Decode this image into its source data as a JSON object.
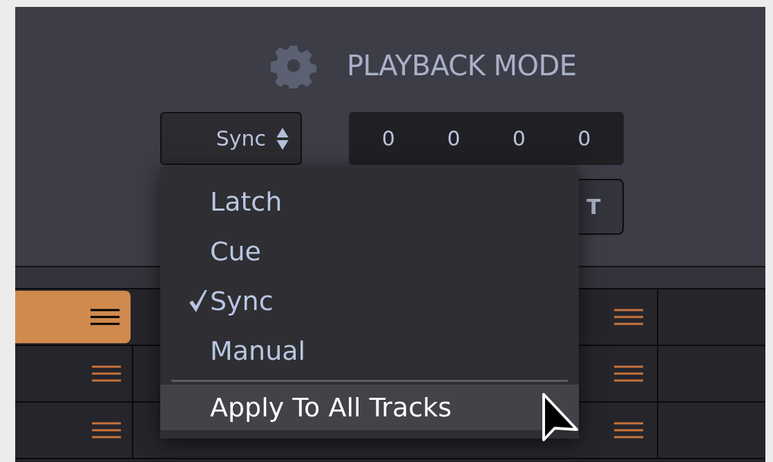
{
  "header": {
    "title": "PLAYBACK MODE"
  },
  "mode_select": {
    "value": "Sync"
  },
  "counter": [
    "0",
    "0",
    "0",
    "0"
  ],
  "hidden_button": {
    "label": "T"
  },
  "menu": {
    "items": [
      {
        "label": "Latch",
        "checked": false
      },
      {
        "label": "Cue",
        "checked": false
      },
      {
        "label": "Sync",
        "checked": true
      },
      {
        "label": "Manual",
        "checked": false
      }
    ],
    "action": {
      "label": "Apply To All Tracks",
      "highlighted": true
    }
  },
  "tracks": [
    {
      "selected": true
    },
    {
      "selected": false
    },
    {
      "selected": false
    }
  ]
}
